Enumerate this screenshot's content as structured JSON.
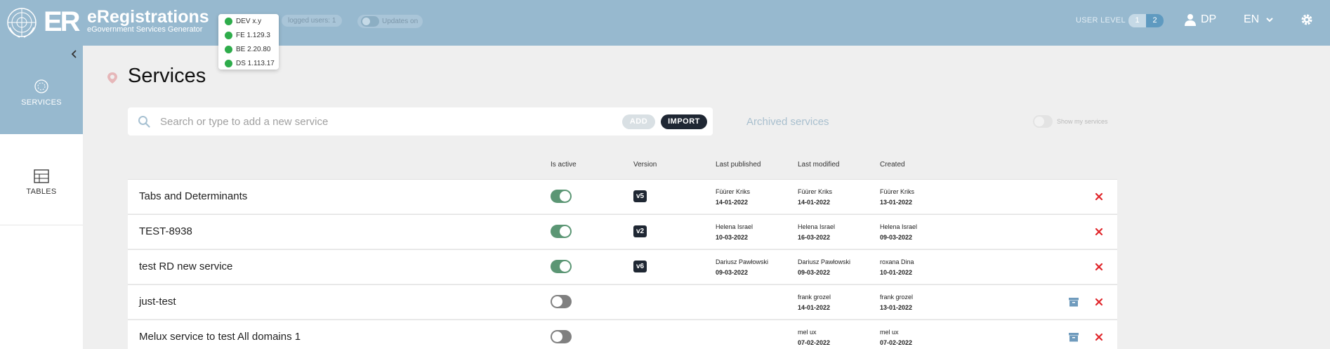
{
  "header": {
    "app_title": "eRegistrations",
    "app_subtitle": "eGovernment Services Generator",
    "logo_text": "ER",
    "env_versions": [
      {
        "label": "DEV x.y"
      },
      {
        "label": "FE 1.129.3"
      },
      {
        "label": "BE 2.20.80"
      },
      {
        "label": "DS 1.113.17"
      }
    ],
    "logged_users": "logged users: 1",
    "updates_label": "Updates on",
    "user_level_label": "USER LEVEL",
    "user_levels": [
      "1",
      "2"
    ],
    "user_initials": "DP",
    "language": "EN"
  },
  "sidebar": {
    "items": [
      {
        "label": "SERVICES",
        "icon": "services-icon"
      },
      {
        "label": "TABLES",
        "icon": "table-icon"
      }
    ]
  },
  "main": {
    "title": "Services",
    "search_placeholder": "Search or type to add a new service",
    "add_label": "ADD",
    "import_label": "IMPORT",
    "archived_link": "Archived services",
    "show_my_services": "Show my services",
    "columns": [
      "Is active",
      "Version",
      "Last published",
      "Last modified",
      "Created"
    ],
    "rows": [
      {
        "name": "Tabs and Determinants",
        "active": true,
        "version": "v5",
        "published_by": "Füürer Kriks",
        "published_date": "14-01-2022",
        "modified_by": "Füürer Kriks",
        "modified_date": "14-01-2022",
        "created_by": "Füürer Kriks",
        "created_date": "13-01-2022",
        "archive": false
      },
      {
        "name": "TEST-8938",
        "active": true,
        "version": "v2",
        "published_by": "Helena Israel",
        "published_date": "10-03-2022",
        "modified_by": "Helena Israel",
        "modified_date": "16-03-2022",
        "created_by": "Helena Israel",
        "created_date": "09-03-2022",
        "archive": false
      },
      {
        "name": "test RD new service",
        "active": true,
        "version": "v6",
        "published_by": "Dariusz Pawłowski",
        "published_date": "09-03-2022",
        "modified_by": "Dariusz Pawłowski",
        "modified_date": "09-03-2022",
        "created_by": "roxana Dina",
        "created_date": "10-01-2022",
        "archive": false
      },
      {
        "name": "just-test",
        "active": false,
        "version": "",
        "published_by": "",
        "published_date": "",
        "modified_by": "frank grozel",
        "modified_date": "14-01-2022",
        "created_by": "frank grozel",
        "created_date": "13-01-2022",
        "archive": true
      },
      {
        "name": "Melux service to test All domains 1",
        "active": false,
        "version": "",
        "published_by": "",
        "published_date": "",
        "modified_by": "mel ux",
        "modified_date": "07-02-2022",
        "created_by": "mel ux",
        "created_date": "07-02-2022",
        "archive": true
      }
    ]
  },
  "colors": {
    "header_bg": "#97b9cf",
    "active_toggle": "#5b9674",
    "delete": "#e0262b",
    "badge": "#1f2733"
  }
}
